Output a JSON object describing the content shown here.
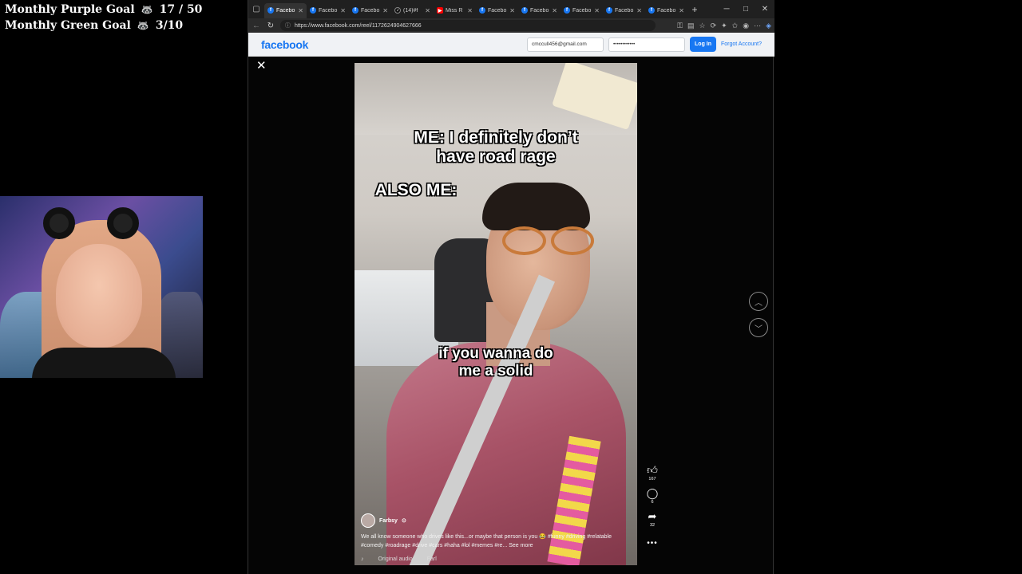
{
  "overlay": {
    "goals": [
      {
        "label": "Monthly Purple Goal",
        "icon": "raccoon-icon",
        "value": "17 / 50"
      },
      {
        "label": "Monthly Green Goal",
        "icon": "raccoon-icon",
        "value": "3/10"
      }
    ]
  },
  "browser": {
    "tabs": [
      {
        "title": "Facebo",
        "favicon": "facebook",
        "active": true
      },
      {
        "title": "Facebo",
        "favicon": "facebook",
        "active": false
      },
      {
        "title": "Facebo",
        "favicon": "facebook",
        "active": false
      },
      {
        "title": "(14)#f",
        "favicon": "tiktok",
        "active": false
      },
      {
        "title": "Miss R",
        "favicon": "youtube",
        "active": false
      },
      {
        "title": "Facebo",
        "favicon": "facebook",
        "active": false
      },
      {
        "title": "Facebo",
        "favicon": "facebook",
        "active": false
      },
      {
        "title": "Facebo",
        "favicon": "facebook",
        "active": false
      },
      {
        "title": "Facebo",
        "favicon": "facebook",
        "active": false
      },
      {
        "title": "Facebo",
        "favicon": "facebook",
        "active": false
      }
    ],
    "url": "https://www.facebook.com/reel/1172624904627666"
  },
  "facebook": {
    "logo": "facebook",
    "email_value": "cmccull456@gmail.com",
    "password_value": "••••••••••••",
    "login_label": "Log In",
    "forgot_label": "Forgot Account?"
  },
  "reel": {
    "caption_1": "ME: I definitely don’t have road rage",
    "caption_2": "ALSO ME:",
    "caption_3": "if you wanna do me a solid",
    "author": "Farbsy",
    "description": "We all know someone who drives like this...or maybe that person is you 😂 #funny #driving #relatable #comedy #roadrage #drive #cars #haha #lol #memes #re... See more",
    "audio_label": "Original audio",
    "audio_author": "Farl",
    "likes": "167",
    "comments": "6",
    "shares": "32"
  },
  "colors": {
    "facebook_blue": "#1877f2",
    "tab_bar": "#202020",
    "reel_background": "#050505"
  }
}
